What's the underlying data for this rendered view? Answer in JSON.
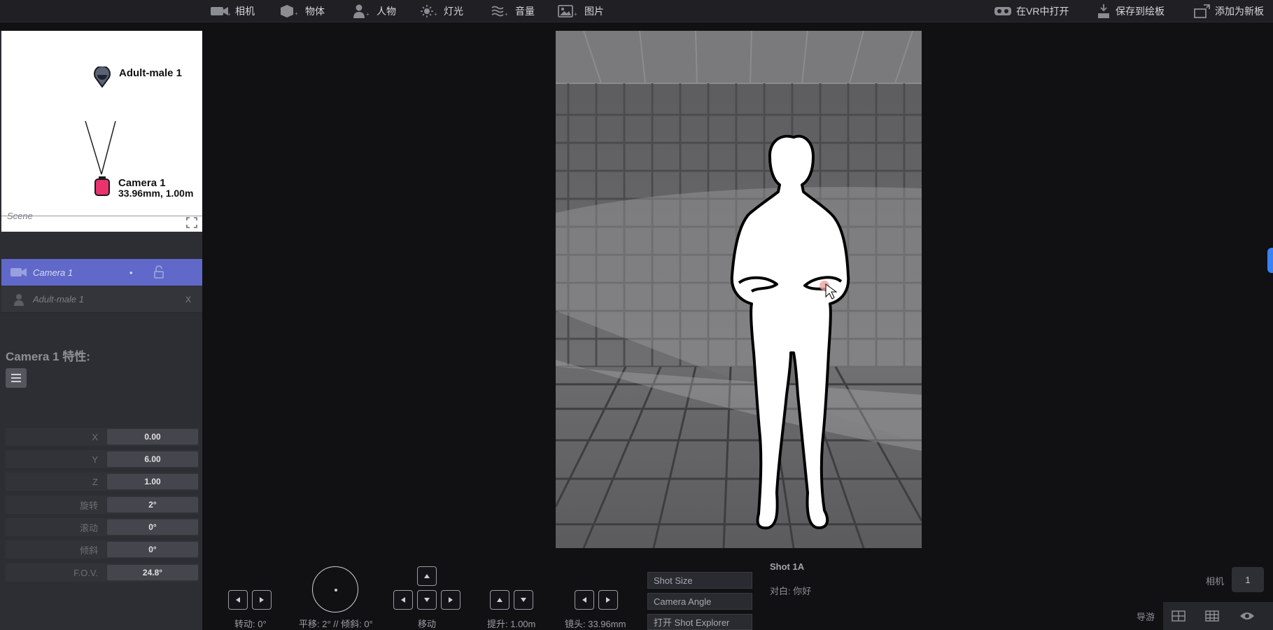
{
  "toolbar": {
    "camera": "相机",
    "object": "物体",
    "character": "人物",
    "light": "灯光",
    "sound": "音量",
    "image": "图片",
    "open_vr": "在VR中打开",
    "save_board": "保存到绘板",
    "add_board": "添加为新板"
  },
  "map": {
    "character_label": "Adult-male 1",
    "camera_label": "Camera 1",
    "camera_info": "33.96mm, 1.00m"
  },
  "scene": {
    "title": "Scene",
    "items": [
      {
        "label": "Camera 1",
        "dot": "•"
      },
      {
        "label": "Adult-male 1",
        "close": "X"
      }
    ]
  },
  "properties": {
    "title": "Camera 1 特性:",
    "rows": [
      {
        "label": "X",
        "value": "0.00"
      },
      {
        "label": "Y",
        "value": "6.00"
      },
      {
        "label": "Z",
        "value": "1.00"
      },
      {
        "label": "旋转",
        "value": "2°"
      },
      {
        "label": "滚动",
        "value": "0°"
      },
      {
        "label": "倾斜",
        "value": "0°"
      },
      {
        "label": "F.O.V.",
        "value": "24.8°"
      }
    ]
  },
  "controls": {
    "rotate": "转动: 0°",
    "pan_tilt": "平移: 2° // 倾斜: 0°",
    "move": "移动",
    "lift": "提升: 1.00m",
    "lens": "镜头: 33.96mm",
    "shot_size": "Shot Size",
    "camera_angle": "Camera Angle",
    "open_explorer": "打开 Shot Explorer"
  },
  "shot": {
    "title": "Shot 1A",
    "dialogue": "对白: 你好"
  },
  "camera_selector": {
    "label": "相机",
    "value": "1"
  },
  "nav": {
    "label": "导游"
  },
  "colors": {
    "selected_row": "#6069c9",
    "camera_marker": "#e8336d",
    "accent_tab": "#3b82f6"
  }
}
